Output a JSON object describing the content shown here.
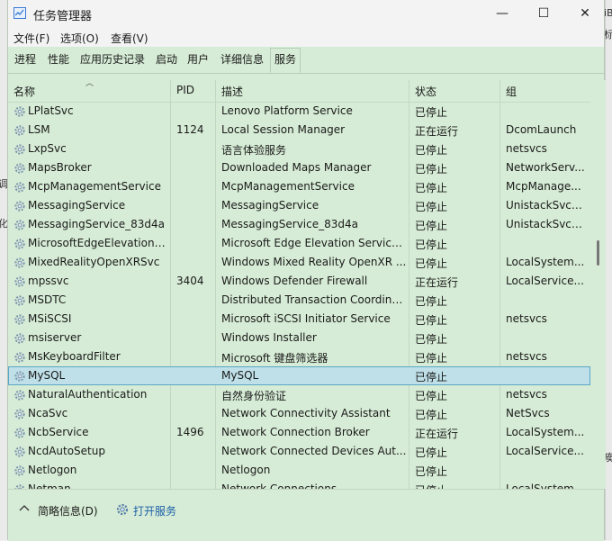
{
  "window": {
    "title": "任务管理器",
    "minimize_glyph": "—",
    "maximize_glyph": "☐",
    "close_glyph": "✕"
  },
  "background_fragments": [
    "iB",
    "标",
    "调",
    "化",
    "痪"
  ],
  "menu": [
    "文件(F)",
    "选项(O)",
    "查看(V)"
  ],
  "tabs": [
    "进程",
    "性能",
    "应用历史记录",
    "启动",
    "用户",
    "详细信息",
    "服务"
  ],
  "active_tab": "服务",
  "columns": {
    "name": "名称",
    "pid": "PID",
    "desc": "描述",
    "status": "状态",
    "group": "组"
  },
  "rows": [
    {
      "name": "LPlatSvc",
      "pid": "",
      "desc": "Lenovo Platform Service",
      "status": "已停止",
      "group": ""
    },
    {
      "name": "LSM",
      "pid": "1124",
      "desc": "Local Session Manager",
      "status": "正在运行",
      "group": "DcomLaunch"
    },
    {
      "name": "LxpSvc",
      "pid": "",
      "desc": "语言体验服务",
      "status": "已停止",
      "group": "netsvcs"
    },
    {
      "name": "MapsBroker",
      "pid": "",
      "desc": "Downloaded Maps Manager",
      "status": "已停止",
      "group": "NetworkServ..."
    },
    {
      "name": "McpManagementService",
      "pid": "",
      "desc": "McpManagementService",
      "status": "已停止",
      "group": "McpManage..."
    },
    {
      "name": "MessagingService",
      "pid": "",
      "desc": "MessagingService",
      "status": "已停止",
      "group": "UnistackSvcG..."
    },
    {
      "name": "MessagingService_83d4a",
      "pid": "",
      "desc": "MessagingService_83d4a",
      "status": "已停止",
      "group": "UnistackSvcG..."
    },
    {
      "name": "MicrosoftEdgeElevationS...",
      "pid": "",
      "desc": "Microsoft Edge Elevation Service...",
      "status": "已停止",
      "group": ""
    },
    {
      "name": "MixedRealityOpenXRSvc",
      "pid": "",
      "desc": "Windows Mixed Reality OpenXR ...",
      "status": "已停止",
      "group": "LocalSystem..."
    },
    {
      "name": "mpssvc",
      "pid": "3404",
      "desc": "Windows Defender Firewall",
      "status": "正在运行",
      "group": "LocalService..."
    },
    {
      "name": "MSDTC",
      "pid": "",
      "desc": "Distributed Transaction Coordina...",
      "status": "已停止",
      "group": ""
    },
    {
      "name": "MSiSCSI",
      "pid": "",
      "desc": "Microsoft iSCSI Initiator Service",
      "status": "已停止",
      "group": "netsvcs"
    },
    {
      "name": "msiserver",
      "pid": "",
      "desc": "Windows Installer",
      "status": "已停止",
      "group": ""
    },
    {
      "name": "MsKeyboardFilter",
      "pid": "",
      "desc": "Microsoft 键盘筛选器",
      "status": "已停止",
      "group": "netsvcs"
    },
    {
      "name": "MySQL",
      "pid": "",
      "desc": "MySQL",
      "status": "已停止",
      "group": "",
      "selected": true
    },
    {
      "name": "NaturalAuthentication",
      "pid": "",
      "desc": "自然身份验证",
      "status": "已停止",
      "group": "netsvcs"
    },
    {
      "name": "NcaSvc",
      "pid": "",
      "desc": "Network Connectivity Assistant",
      "status": "已停止",
      "group": "NetSvcs"
    },
    {
      "name": "NcbService",
      "pid": "1496",
      "desc": "Network Connection Broker",
      "status": "正在运行",
      "group": "LocalSystem..."
    },
    {
      "name": "NcdAutoSetup",
      "pid": "",
      "desc": "Network Connected Devices Aut...",
      "status": "已停止",
      "group": "LocalService..."
    },
    {
      "name": "Netlogon",
      "pid": "",
      "desc": "Netlogon",
      "status": "已停止",
      "group": ""
    },
    {
      "name": "Netman",
      "pid": "",
      "desc": "Network Connections",
      "status": "已停止",
      "group": "LocalSystem..."
    }
  ],
  "footer": {
    "toggle_label": "简略信息(D)",
    "open_services_label": "打开服务"
  },
  "colors": {
    "panel": "#d6ecd6",
    "selected_row": "#bfe0e8",
    "link": "#1b5fa8"
  }
}
